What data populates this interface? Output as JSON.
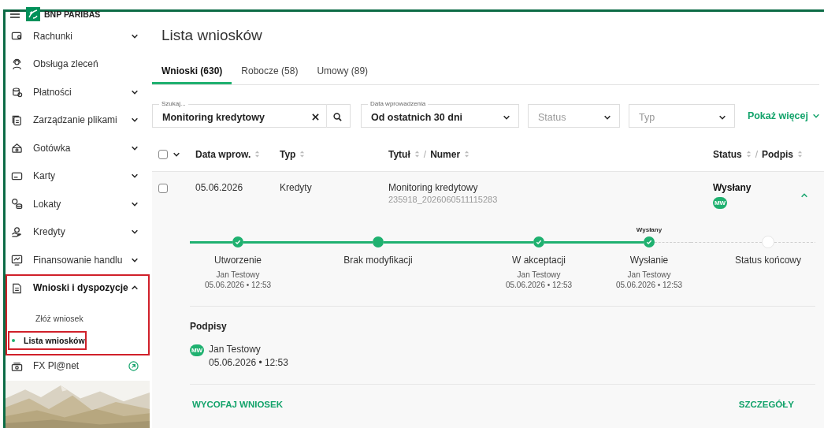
{
  "sidebar": {
    "logo": "BNP PARIBAS",
    "items": [
      {
        "label": "Rachunki",
        "kind": "group",
        "expanded": false
      },
      {
        "label": "Obsługa zleceń",
        "kind": "link"
      },
      {
        "label": "Płatności",
        "kind": "group",
        "expanded": false
      },
      {
        "label": "Zarządzanie plikami",
        "kind": "group",
        "expanded": false
      },
      {
        "label": "Gotówka",
        "kind": "group",
        "expanded": false
      },
      {
        "label": "Karty",
        "kind": "group",
        "expanded": false
      },
      {
        "label": "Lokaty",
        "kind": "group",
        "expanded": false
      },
      {
        "label": "Kredyty",
        "kind": "group",
        "expanded": false
      },
      {
        "label": "Finansowanie handlu",
        "kind": "group",
        "expanded": false
      },
      {
        "label": "Wnioski i dyspozycje",
        "kind": "group",
        "expanded": true,
        "highlighted": true,
        "children": [
          {
            "label": "Złóż wniosek",
            "selected": false,
            "highlighted": false
          },
          {
            "label": "Lista wniosków",
            "selected": true,
            "highlighted": true
          }
        ]
      },
      {
        "label": "FX Pl@net",
        "kind": "external"
      }
    ]
  },
  "page_title": "Lista wniosków",
  "tabs": [
    {
      "label": "Wnioski (630)",
      "selected": true
    },
    {
      "label": "Robocze (58)",
      "selected": false
    },
    {
      "label": "Umowy (89)",
      "selected": false
    }
  ],
  "filters": {
    "search": {
      "label": "Szukaj...",
      "value": "Monitoring kredytowy"
    },
    "date": {
      "label": "Data wprowadzenia",
      "value": "Od ostatnich 30 dni"
    },
    "status": {
      "placeholder": "Status"
    },
    "type": {
      "placeholder": "Typ"
    },
    "show_more": "Pokaż więcej"
  },
  "table": {
    "select_all": {
      "checked": false
    },
    "columns": [
      {
        "label": "Data wprow.",
        "sortable": true
      },
      {
        "label": "Typ",
        "sortable": true
      },
      {
        "label": "Tytuł",
        "sortable": true,
        "secondary_label": "Numer",
        "separator": "/"
      },
      {
        "label": "Status",
        "sortable": true,
        "secondary_label": "Podpis",
        "separator": "/"
      }
    ],
    "rows": [
      {
        "checked": false,
        "date": "05.06.2026",
        "type": "Kredyty",
        "title": "Monitoring kredytowy",
        "number": "235918_2026060511115283",
        "status": "Wysłany",
        "signer_initials": "MW",
        "expanded": true,
        "details": {
          "steps": [
            {
              "label": "Utworzenie",
              "person": "Jan Testowy",
              "date": "05.06.2026 • 12:53",
              "reached": true,
              "completed": true
            },
            {
              "label": "Brak modyfikacji",
              "reached": true,
              "completed": false
            },
            {
              "label": "W akceptacji",
              "person": "Jan Testowy",
              "date": "05.06.2026 • 12:53",
              "reached": true,
              "completed": true
            },
            {
              "label": "Wysłanie",
              "badge": "Wysłany",
              "person": "Jan Testowy",
              "date": "05.06.2026 • 12:53",
              "reached": true,
              "completed": true
            },
            {
              "label": "Status końcowy",
              "reached": false
            }
          ],
          "signatures": {
            "title": "Podpisy",
            "items": [
              {
                "initials": "MW",
                "name": "Jan Testowy",
                "date": "05.06.2026 • 12:53"
              }
            ]
          },
          "actions": [
            {
              "label": "WYCOFAJ WNIOSEK"
            },
            {
              "label": "SZCZEGÓŁY"
            }
          ]
        }
      }
    ]
  }
}
